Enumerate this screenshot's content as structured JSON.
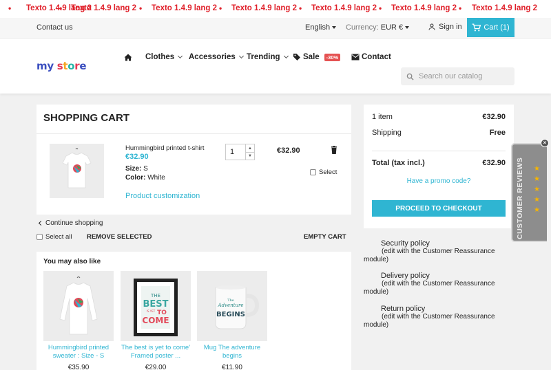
{
  "marquee": {
    "items": [
      "Texto 1.4.9 lang 2",
      "Texto 1.4.9 lang 2",
      "Texto 1.4.9 lang 2",
      "Texto 1.4.9 lang 2",
      "Texto 1.4.9 lang 2",
      "Texto 1.4.9 lang 2",
      "Texto 1.4.9 lang 2"
    ],
    "separator": "•"
  },
  "topnav": {
    "contact": "Contact us",
    "language": "English",
    "currency_label": "Currency:",
    "currency_value": "EUR €",
    "signin": "Sign in",
    "cart": "Cart (1)"
  },
  "header": {
    "logo": {
      "part1": "my",
      "s1": "s",
      "s2": "t",
      "s3": "o",
      "s4": "r",
      "s5": "e"
    },
    "menu": {
      "clothes": "Clothes",
      "accessories": "Accessories",
      "trending": "Trending",
      "sale": "Sale",
      "sale_badge": "-30%",
      "contact": "Contact"
    },
    "search_placeholder": "Search our catalog"
  },
  "cart": {
    "title": "Shopping Cart",
    "product": {
      "name": "Hummingbird printed t-shirt",
      "price": "€32.90",
      "size_label": "Size:",
      "size": "S",
      "color_label": "Color:",
      "color": "White",
      "customization": "Product customization",
      "quantity": "1",
      "line_total": "€32.90",
      "select_label": "Select"
    },
    "continue": "Continue shopping",
    "select_all": "Select all",
    "remove_selected": "Remove selected",
    "empty_cart": "Empty cart"
  },
  "also_like": {
    "title": "You may also like",
    "items": [
      {
        "name": "Hummingbird printed sweater : Size - S",
        "price": "€35.90"
      },
      {
        "name": "The best is yet to come' Framed poster ...",
        "price": "€29.00"
      },
      {
        "name": "Mug The adventure begins",
        "price": "€11.90"
      }
    ]
  },
  "poster": {
    "l1": "THE",
    "l2": "BEST",
    "l3": "IS YET",
    "l4": "TO",
    "l5": "COME"
  },
  "mug": {
    "l1": "The",
    "l2": "Adventure",
    "l3": "BEGINS"
  },
  "summary": {
    "items_label": "1 item",
    "items_value": "€32.90",
    "shipping_label": "Shipping",
    "shipping_value": "Free",
    "total_label": "Total (tax incl.)",
    "total_value": "€32.90",
    "promo": "Have a promo code?",
    "checkout": "Proceed to checkout"
  },
  "reassurance": [
    {
      "title": "Security policy",
      "desc1": "(edit with the Customer Reassurance",
      "desc2": "module)"
    },
    {
      "title": "Delivery policy",
      "desc1": "(edit with the Customer Reassurance",
      "desc2": "module)"
    },
    {
      "title": "Return policy",
      "desc1": "(edit with the Customer Reassurance",
      "desc2": "module)"
    }
  ],
  "reviews": {
    "label": "CUSTOMER REVIEWS",
    "close": "×"
  },
  "colors": {
    "accent": "#2fb5d2",
    "marquee": "#e0202a",
    "badge": "#e55252"
  }
}
